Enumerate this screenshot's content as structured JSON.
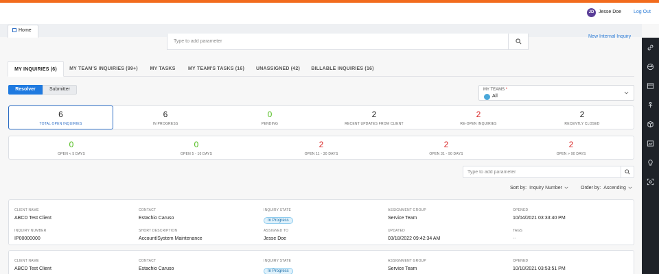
{
  "header": {
    "user_initials": "JD",
    "user_name": "Jesse Doe",
    "logout_label": "Log Out",
    "accent_color": "#f26b1d"
  },
  "tabstrip": {
    "home_label": "Home"
  },
  "top_search": {
    "placeholder": "Type to add parameter",
    "new_inquiry_label": "New Internal Inquiry"
  },
  "right_rail": {
    "icons": [
      "link-icon",
      "dashboard-icon",
      "panel-icon",
      "branch-icon",
      "cube-icon",
      "image-icon",
      "lightbulb-icon",
      "scan-icon"
    ]
  },
  "inquiry_tabs": [
    {
      "label": "MY INQUIRIES (6)",
      "active": true
    },
    {
      "label": "MY TEAM'S INQUIRIES (99+)",
      "active": false
    },
    {
      "label": "MY TASKS",
      "active": false
    },
    {
      "label": "MY TEAM'S TASKS (16)",
      "active": false
    },
    {
      "label": "UNASSIGNED (42)",
      "active": false
    },
    {
      "label": "BILLABLE INQUIRIES (16)",
      "active": false
    }
  ],
  "role_toggle": {
    "resolver": "Resolver",
    "submitter": "Submitter",
    "selected": "Resolver"
  },
  "teams": {
    "label": "MY TEAMS",
    "required_mark": "*",
    "value": "All"
  },
  "stats_primary": [
    {
      "value": "6",
      "label": "TOTAL OPEN INQUIRIES",
      "color": "default"
    },
    {
      "value": "6",
      "label": "IN PROGRESS",
      "color": "default"
    },
    {
      "value": "0",
      "label": "PENDING",
      "color": "green"
    },
    {
      "value": "2",
      "label": "RECENT UPDATES FROM CLIENT",
      "color": "default"
    },
    {
      "value": "2",
      "label": "RE-OPEN INQUIRIES",
      "color": "red"
    },
    {
      "value": "2",
      "label": "RECENTLY CLOSED",
      "color": "default"
    }
  ],
  "stats_age": [
    {
      "value": "0",
      "label": "OPEN < 5 DAYS",
      "color": "green"
    },
    {
      "value": "0",
      "label": "OPEN 5 - 10 DAYS",
      "color": "green"
    },
    {
      "value": "2",
      "label": "OPEN 11 - 30 DAYS",
      "color": "red"
    },
    {
      "value": "2",
      "label": "OPEN 31 - 90 DAYS",
      "color": "red"
    },
    {
      "value": "2",
      "label": "OPEN > 90 DAYS",
      "color": "red"
    }
  ],
  "list_search": {
    "placeholder": "Type to add parameter"
  },
  "sorting": {
    "sort_label": "Sort by:",
    "sort_value": "Inquiry Number",
    "order_label": "Order by:",
    "order_value": "Ascending"
  },
  "field_labels": {
    "client_name": "CLIENT NAME",
    "contact": "CONTACT",
    "inquiry_state": "INQUIRY STATE",
    "assignment_group": "ASSIGNMENT GROUP",
    "opened": "OPENED",
    "inquiry_number": "INQUIRY NUMBER",
    "short_description": "SHORT DESCRIPTION",
    "assigned_to": "ASSIGNED TO",
    "updated": "UPDATED",
    "tags": "TAGS"
  },
  "inquiries": [
    {
      "client_name": "ABCD Test Client",
      "contact": "Estachio Caruso",
      "inquiry_state": "In Progress",
      "assignment_group": "Service Team",
      "opened": "10/04/2021 03:33:40 PM",
      "inquiry_number": "IP00000000",
      "short_description": "Account/System Maintenance",
      "assigned_to": "Jesse Doe",
      "updated": "03/18/2022 09:42:34 AM",
      "tags": "--"
    },
    {
      "client_name": "ABCD Test Client",
      "contact": "Estachio Caruso",
      "inquiry_state": "In Progress",
      "assignment_group": "Service Team",
      "opened": "10/10/2021 03:53:51 PM"
    }
  ]
}
